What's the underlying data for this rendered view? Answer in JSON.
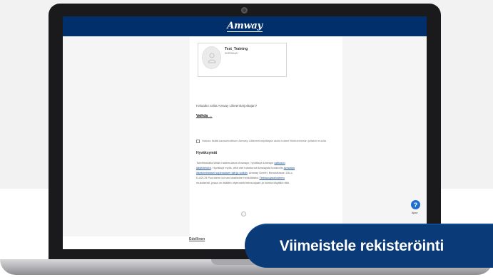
{
  "header": {
    "logo": "Amway"
  },
  "sponsor": {
    "name": "Test_Training",
    "country": "KORSIKAS"
  },
  "question_text": "Haluatko valita Amway Liikeenharjoittajan?",
  "change_link": "Vaihda →",
  "checkbox_label": "Haluan lisätä kansainvälisen Amway Liikkeenharjoittajan aiolla tolaeri liiketoiminnan jollakin muulla Amwayn markkina-alueella.",
  "terms": {
    "title": "Hyväksymät",
    "text_1": "Toimittamalla lähän hakemuksen Amwayn, hyväksyt Amwayn",
    "link_1": "rattiosun käyttöehdot",
    "text_2": ". Hyväksyt myös, että olet tutustunut",
    "text_3": "Amwaysta koskeviin",
    "link_2": "Amwayn liiketoimintasei sopimukset nätt ja sotkiin",
    "text_4": ". Amway GmbH, Benzstrasse 11b-c, D-82178 Puchheim tai sen käsittelee henkilötietoi",
    "link_3": "Tietosuojaselosteen",
    "text_5": " mukaisesti, jossa on lisätäin ohjeusstä tietosuojaan ja kuinka käyttää niitä."
  },
  "help": {
    "icon": "?",
    "label": "Apua"
  },
  "back_label": "Edellinen",
  "cta_label": "Viimeistele rekisteröinti",
  "colors": {
    "header": "#002f6c",
    "cta": "#0a3a78",
    "help": "#1f6fd1"
  }
}
